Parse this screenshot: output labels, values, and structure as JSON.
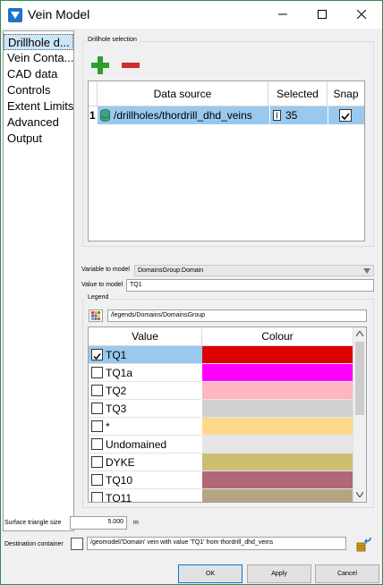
{
  "window": {
    "title": "Vein Model"
  },
  "nav": {
    "items": [
      {
        "label": "Drillhole d..."
      },
      {
        "label": "Vein Conta..."
      },
      {
        "label": "CAD data"
      },
      {
        "label": "Controls"
      },
      {
        "label": "Extent Limits"
      },
      {
        "label": "Advanced"
      },
      {
        "label": "Output"
      }
    ]
  },
  "drillhole": {
    "group_label": "Drillhole selection",
    "headers": {
      "source": "Data source",
      "selected": "Selected",
      "snap": "Snap"
    },
    "rows": [
      {
        "num": "1",
        "source": "/drillholes/thordrill_dhd_veins",
        "selected": "35",
        "snap": true
      }
    ]
  },
  "variable": {
    "label": "Variable to model",
    "value": "DomainsGroup:Domain"
  },
  "value_to_model": {
    "label": "Value to model",
    "value": "TQ1"
  },
  "legend": {
    "group_label": "Legend",
    "path": "/legends/Domains/DomainsGroup",
    "headers": {
      "value": "Value",
      "colour": "Colour"
    },
    "rows": [
      {
        "value": "TQ1",
        "checked": true,
        "color": "#e00000"
      },
      {
        "value": "TQ1a",
        "checked": false,
        "color": "#ff00ff"
      },
      {
        "value": "TQ2",
        "checked": false,
        "color": "#ffb6c1"
      },
      {
        "value": "TQ3",
        "checked": false,
        "color": "#d0d0d0"
      },
      {
        "value": "*",
        "checked": false,
        "color": "#ffd98a"
      },
      {
        "value": "Undomained",
        "checked": false,
        "color": "#e6e6e6"
      },
      {
        "value": "DYKE",
        "checked": false,
        "color": "#cdbf72"
      },
      {
        "value": "TQ10",
        "checked": false,
        "color": "#b06878"
      },
      {
        "value": "TQ11",
        "checked": false,
        "color": "#b4a682"
      }
    ]
  },
  "surface": {
    "label": "Surface triangle size",
    "value": "5.000",
    "unit": "m"
  },
  "destination": {
    "label": "Destination container",
    "value": "/geomodel/'Domain' vein with value 'TQ1' from thordrill_dhd_veins"
  },
  "buttons": {
    "ok": "OK",
    "apply": "Apply",
    "cancel": "Cancel"
  }
}
